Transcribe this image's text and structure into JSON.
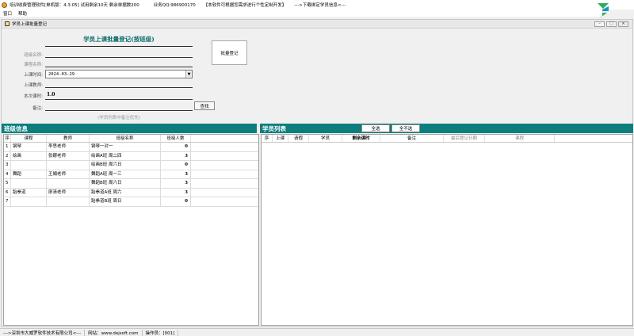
{
  "window": {
    "title": "培训收费管理软件[单机版：4.3.05]  试用剩余10天  剩余单据数200",
    "qq": "业务QQ:986900170",
    "notice": "【本软件可根据您需求进行个性定制开发】",
    "link": "--->下载绑定学员信息<---"
  },
  "menu": [
    {
      "label": "窗口"
    },
    {
      "label": "帮助"
    }
  ],
  "child_window": {
    "title": "学员上课批量登记",
    "buttons": {
      "minimize": "–",
      "maximize": "□",
      "close": "×"
    }
  },
  "form": {
    "title": "学员上课批量登记(按班级)",
    "class_name_label": "班级名称:",
    "course_name_label": "课程名称:",
    "class_time_label": "上课时间:",
    "class_time_value": "2024-03-29",
    "teacher_label": "上课教师:",
    "lesson_count_label": "本次课时:",
    "lesson_count_value": "1.0",
    "remark_label": "备注:",
    "search_button": "查找",
    "batch_button": "批量登记",
    "hint": "(学员列表中备注优先)"
  },
  "class_panel": {
    "title": "班级信息",
    "columns": [
      "序",
      "课程",
      "教师",
      "班级名称",
      "班级人数"
    ],
    "rows": [
      {
        "no": "1",
        "course": "钢琴",
        "teacher": "李思老师",
        "class": "钢琴一对一",
        "count": "0"
      },
      {
        "no": "2",
        "course": "绘画",
        "teacher": "张娜老师",
        "class": "绘画A班  周二四",
        "count": "3"
      },
      {
        "no": "3",
        "course": "",
        "teacher": "",
        "class": "绘画B班  周六日",
        "count": "0"
      },
      {
        "no": "4",
        "course": "舞蹈",
        "teacher": "王娟老师",
        "class": "舞蹈A班  周一三",
        "count": "3"
      },
      {
        "no": "5",
        "course": "",
        "teacher": "",
        "class": "舞蹈B班  周六日",
        "count": "3"
      },
      {
        "no": "6",
        "course": "跆拳道",
        "teacher": "廖清老师",
        "class": "跆拳道A班  周六",
        "count": "3"
      },
      {
        "no": "7",
        "course": "",
        "teacher": "",
        "class": "跆拳道B班  周日",
        "count": "0"
      }
    ]
  },
  "student_panel": {
    "title": "学员列表",
    "select_all": "全选",
    "deselect_all": "全不选",
    "columns": [
      "序",
      "上课",
      "请假",
      "学员",
      "剩余课时",
      "备注",
      "最后登记日期",
      "课程"
    ]
  },
  "status": {
    "company": "--->深圳市大威罗软件技术有限公司<---",
    "website": "网站：www.dejsoft.com",
    "operator": "操作员：[001]"
  }
}
